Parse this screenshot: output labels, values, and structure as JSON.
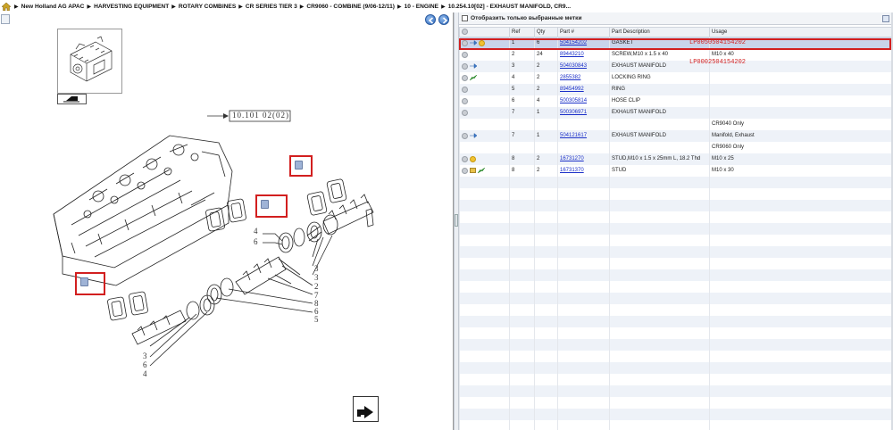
{
  "breadcrumbs": [
    "New Holland AG APAC",
    "HARVESTING EQUIPMENT",
    "ROTARY COMBINES",
    "CR SERIES TIER 3",
    "CR9060 - COMBINE (9/06-12/11)",
    "10 - ENGINE",
    "10.254.10[02] - EXHAUST MANIFOLD, CR9..."
  ],
  "diagram": {
    "ref_code": "10.101 02(02)",
    "callout_numbers": {
      "group_a": [
        "4",
        "6"
      ],
      "group_b": [
        "3",
        "3",
        "2",
        "7",
        "8",
        "6",
        "5"
      ],
      "group_c": [
        "3",
        "6",
        "4"
      ]
    }
  },
  "filter": {
    "label": "Отобразить только выбранные метки"
  },
  "table": {
    "headers": [
      "Ref",
      "Qty",
      "Part #",
      "Part Description",
      "Usage"
    ],
    "rows": [
      {
        "icons": [
          "circle",
          "blue",
          "yellow"
        ],
        "ref": "1",
        "qty": "6",
        "part": "504154202",
        "desc": "GASKET",
        "usage": "",
        "selected": true
      },
      {
        "icons": [
          "circle"
        ],
        "ref": "2",
        "qty": "24",
        "part": "89443210",
        "desc": "SCREW,M10 x 1.5 x 40",
        "usage": "M10 x 40"
      },
      {
        "icons": [
          "circle",
          "blue"
        ],
        "ref": "3",
        "qty": "2",
        "part": "504030843",
        "desc": "EXHAUST MANIFOLD",
        "usage": ""
      },
      {
        "icons": [
          "circle",
          "green"
        ],
        "ref": "4",
        "qty": "2",
        "part": "2855382",
        "desc": "LOCKING RING",
        "usage": ""
      },
      {
        "icons": [
          "circle"
        ],
        "ref": "5",
        "qty": "2",
        "part": "89454992",
        "desc": "RING",
        "usage": ""
      },
      {
        "icons": [
          "circle"
        ],
        "ref": "6",
        "qty": "4",
        "part": "500305814",
        "desc": "HOSE CLIP",
        "usage": ""
      },
      {
        "icons": [
          "circle"
        ],
        "ref": "7",
        "qty": "1",
        "part": "500306971",
        "desc": "EXHAUST MANIFOLD",
        "usage": ""
      },
      {
        "icons": [],
        "ref": "",
        "qty": "",
        "part": "",
        "desc": "",
        "usage": "CR9040 Only"
      },
      {
        "icons": [
          "circle",
          "blue"
        ],
        "ref": "7",
        "qty": "1",
        "part": "504121617",
        "desc": "EXHAUST MANIFOLD",
        "usage": "Manifold, Exhaust"
      },
      {
        "icons": [],
        "ref": "",
        "qty": "",
        "part": "",
        "desc": "",
        "usage": "CR9060 Only"
      },
      {
        "icons": [
          "circle",
          "yellow"
        ],
        "ref": "8",
        "qty": "2",
        "part": "16731270",
        "desc": "STUD,M10 x 1.5 x 25mm L, 18.2 Thd",
        "usage": "M10 x 25"
      },
      {
        "icons": [
          "circle",
          "book",
          "green"
        ],
        "ref": "8",
        "qty": "2",
        "part": "16731370",
        "desc": "STUD",
        "usage": "M10 x 30"
      }
    ],
    "empty_rows": 22
  },
  "annotations": {
    "lp1": "LP0050504154202",
    "lp2": "LP0002504154202"
  },
  "colors": {
    "highlight_red": "#d21f1f",
    "link_blue": "#1a2fc8",
    "selected_row": "#c9d4ea"
  }
}
